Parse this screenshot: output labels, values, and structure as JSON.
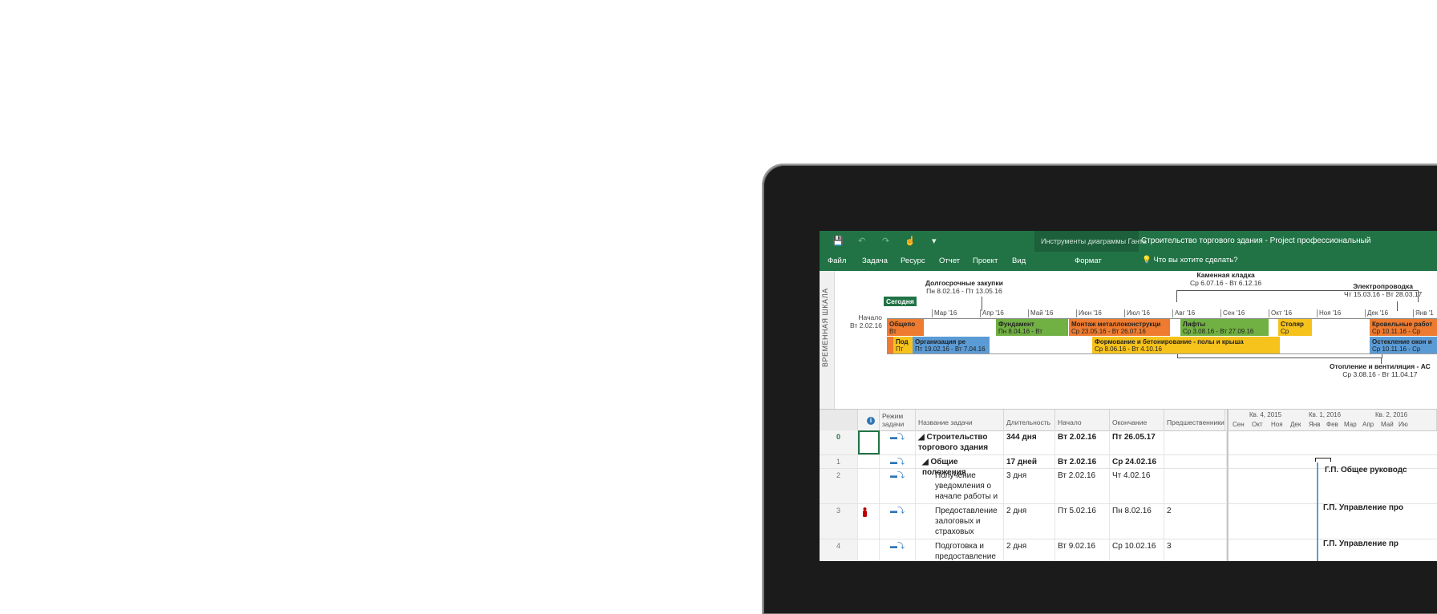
{
  "ribbon": {
    "qa_save": "💾",
    "qa_undo": "↶",
    "qa_redo": "↷",
    "qa_touch": "☝",
    "qa_more": "▾",
    "context_group": "Инструменты диаграммы Ганта",
    "app_title": "Строительство торгового здания - Project профессиональный",
    "tabs": [
      "Файл",
      "Задача",
      "Ресурс",
      "Отчет",
      "Проект",
      "Вид"
    ],
    "context_tab": "Формат",
    "tell_me": "Что вы хотите сделать?"
  },
  "timeline": {
    "side_label": "ВРЕМЕННАЯ ШКАЛА",
    "today": "Сегодня",
    "start_label": "Начало",
    "start_date": "Вт 2.02.16",
    "months": [
      "Мар '16",
      "Апр '16",
      "Май '16",
      "Июн '16",
      "Июл '16",
      "Авг '16",
      "Сен '16",
      "Окт '16",
      "Ноя '16",
      "Дек '16",
      "Янв '1"
    ],
    "callouts": [
      {
        "title": "Долгосрочные закупки",
        "dates": "Пн 8.02.16 - Пт 13.05.16"
      },
      {
        "title": "Каменная кладка",
        "dates": "Ср 6.07.16 - Вт 6.12.16"
      },
      {
        "title": "Электропроводка",
        "dates": "Чт 15.03.16 - Вт 28.03.17"
      },
      {
        "title": "Отопление и вентиляция - АС",
        "dates": "Ср 3.08.16 - Вт 11.04.17"
      }
    ],
    "bars": [
      {
        "title": "Общепо",
        "dates": "Вт",
        "color": "orange"
      },
      {
        "title": "Фундамент",
        "dates": "Пн 8.04.16 - Вт",
        "color": "green"
      },
      {
        "title": "Монтаж металлоконструкци",
        "dates": "Ср 23.05.16 - Вт 26.07.16",
        "color": "orange"
      },
      {
        "title": "Лифты",
        "dates": "Ср 3.08.16 - Вт 27.09.16",
        "color": "green"
      },
      {
        "title": "Столяр",
        "dates": "Ср",
        "color": "yellow"
      },
      {
        "title": "Кровельные работ",
        "dates": "Ср 10.11.16 - Ср",
        "color": "orange"
      },
      {
        "title": "Под",
        "dates": "Пт",
        "color": "yellow"
      },
      {
        "title": "Организация ре",
        "dates": "Пт 19.02.16 - Вт 7.04.16",
        "color": "blue"
      },
      {
        "title": "Формование и бетонирование - полы и крыша",
        "dates": "Ср 8.06.16 - Вт 4.10.16",
        "color": "yellow"
      },
      {
        "title": "Остекление окон и",
        "dates": "Ср 10.11.16 - Ср",
        "color": "blue"
      }
    ]
  },
  "grid": {
    "headers": {
      "mode": "Режим задачи",
      "name": "Название задачи",
      "duration": "Длительность",
      "start": "Начало",
      "finish": "Окончание",
      "predecessors": "Предшественники"
    },
    "gantt_quarters": [
      "Кв. 4, 2015",
      "Кв. 1, 2016",
      "Кв. 2, 2016"
    ],
    "gantt_months": [
      "Сен",
      "Окт",
      "Ноя",
      "Дек",
      "Янв",
      "Фев",
      "Мар",
      "Апр",
      "Май",
      "Ию"
    ],
    "rows": [
      {
        "id": "0",
        "name": "Строительство торгового здания",
        "duration": "344 дня",
        "start": "Вт 2.02.16",
        "finish": "Пт 26.05.17",
        "pred": ""
      },
      {
        "id": "1",
        "name": "Общие положения",
        "duration": "17 дней",
        "start": "Вт 2.02.16",
        "finish": "Ср 24.02.16",
        "pred": ""
      },
      {
        "id": "2",
        "name": "Получение уведомления о начале работы и",
        "duration": "3 дня",
        "start": "Вт 2.02.16",
        "finish": "Чт 4.02.16",
        "pred": ""
      },
      {
        "id": "3",
        "name": "Предоставление залоговых и страховых",
        "duration": "2 дня",
        "start": "Пт 5.02.16",
        "finish": "Пн 8.02.16",
        "pred": "2"
      },
      {
        "id": "4",
        "name": "Подготовка и предоставление",
        "duration": "2 дня",
        "start": "Вт 9.02.16",
        "finish": "Ср 10.02.16",
        "pred": "3"
      }
    ],
    "gantt_labels": [
      "Г.П. Общее руководс",
      "Г.П. Управление про",
      "Г.П. Управление пр"
    ]
  }
}
